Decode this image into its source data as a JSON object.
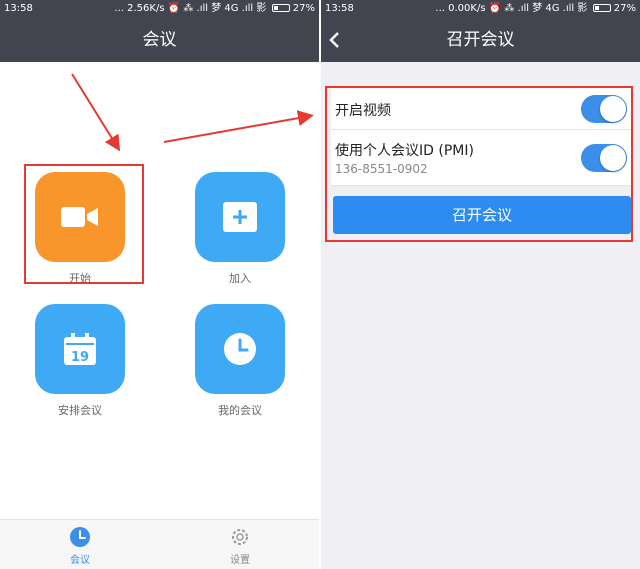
{
  "left": {
    "status": {
      "time": "13:58",
      "info": "... 2.56K/s ⏰ ⁂ .ıll 梦 4G .ıll 影",
      "battery": "27%"
    },
    "title": "会议",
    "tiles": [
      {
        "label": "开始",
        "icon": "video-camera-icon",
        "color": "#f8962c"
      },
      {
        "label": "加入",
        "icon": "plus-icon",
        "color": "#3eaaf6"
      },
      {
        "label": "安排会议",
        "icon": "calendar-icon",
        "color": "#3eaaf6",
        "day": "19"
      },
      {
        "label": "我的会议",
        "icon": "clock-icon",
        "color": "#3eaaf6"
      }
    ],
    "tabs": [
      {
        "label": "会议",
        "icon": "clock-icon",
        "active": true
      },
      {
        "label": "设置",
        "icon": "gear-icon",
        "active": false
      }
    ]
  },
  "right": {
    "status": {
      "time": "13:58",
      "info": "... 0.00K/s ⏰ ⁂ .ıll 梦 4G .ıll 影",
      "battery": "27%"
    },
    "title": "召开会议",
    "rows": [
      {
        "label": "开启视频",
        "toggle_on": true
      },
      {
        "label": "使用个人会议ID (PMI)",
        "sub": "136-8551-0902",
        "toggle_on": true
      }
    ],
    "button": "召开会议"
  },
  "colors": {
    "accent": "#2d8cf0",
    "highlight": "#e53a32",
    "nav": "#42454f"
  }
}
